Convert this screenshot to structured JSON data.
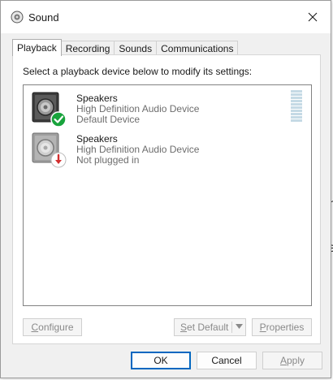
{
  "window": {
    "title": "Sound"
  },
  "tabs": [
    {
      "label": "Playback",
      "active": true
    },
    {
      "label": "Recording",
      "active": false
    },
    {
      "label": "Sounds",
      "active": false
    },
    {
      "label": "Communications",
      "active": false
    }
  ],
  "playback": {
    "instruction": "Select a playback device below to modify its settings:",
    "devices": [
      {
        "name": "Speakers",
        "driver": "High Definition Audio Device",
        "status": "Default Device",
        "badge": "check-icon"
      },
      {
        "name": "Speakers",
        "driver": "High Definition Audio Device",
        "status": "Not plugged in",
        "badge": "unplugged-arrow-icon"
      }
    ],
    "buttons": {
      "configure": {
        "accel": "C",
        "rest": "onfigure"
      },
      "set_default": {
        "accel": "S",
        "rest": "et Default"
      },
      "properties": {
        "accel": "P",
        "rest": "roperties"
      }
    }
  },
  "footer": {
    "ok": "OK",
    "cancel": "Cancel",
    "apply": {
      "accel": "A",
      "rest": "pply"
    }
  },
  "colors": {
    "accent": "#0067c0",
    "check_badge": "#18a33c",
    "unplugged_badge": "#d32f2f",
    "meter": "#c5dae5"
  }
}
